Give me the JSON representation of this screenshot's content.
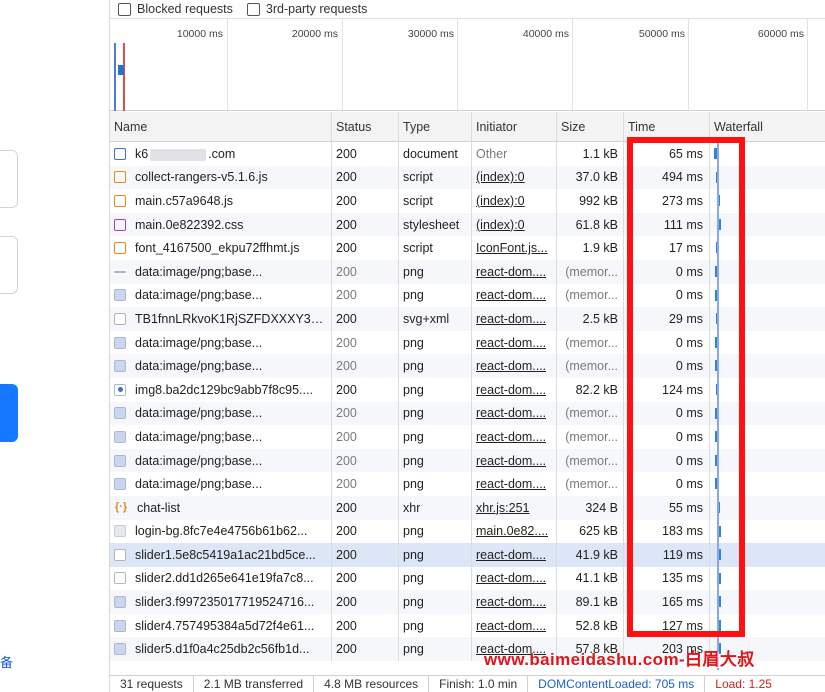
{
  "filters": {
    "blocked_requests": "Blocked requests",
    "third_party": "3rd-party requests"
  },
  "overview": {
    "ticks": [
      "10000 ms",
      "20000 ms",
      "30000 ms",
      "40000 ms",
      "50000 ms",
      "60000 ms"
    ]
  },
  "columns": {
    "name": "Name",
    "status": "Status",
    "type": "Type",
    "initiator": "Initiator",
    "size": "Size",
    "time": "Time",
    "waterfall": "Waterfall"
  },
  "rows": [
    {
      "icon": "document-icon",
      "name_prefix": "k6",
      "name_suffix": ".com",
      "status": "200",
      "type": "document",
      "initiator": "Other",
      "size": "1.1 kB",
      "time": "65 ms"
    },
    {
      "icon": "script-icon",
      "name": "collect-rangers-v5.1.6.js",
      "status": "200",
      "type": "script",
      "initiator": "(index):0",
      "size": "37.0 kB",
      "time": "494 ms"
    },
    {
      "icon": "script-icon",
      "name": "main.c57a9648.js",
      "status": "200",
      "type": "script",
      "initiator": "(index):0",
      "size": "992 kB",
      "time": "273 ms"
    },
    {
      "icon": "stylesheet-icon",
      "name": "main.0e822392.css",
      "status": "200",
      "type": "stylesheet",
      "initiator": "(index):0",
      "size": "61.8 kB",
      "time": "111 ms"
    },
    {
      "icon": "script-icon",
      "name": "font_4167500_ekpu72ffhmt.js",
      "status": "200",
      "type": "script",
      "initiator": "IconFont.js...",
      "size": "1.9 kB",
      "time": "17 ms"
    },
    {
      "icon": "line-image-icon",
      "name": "data:image/png;base...",
      "status": "200",
      "type": "png",
      "initiator": "react-dom....",
      "size": "(memor...",
      "time": "0 ms"
    },
    {
      "icon": "image-icon",
      "name": "data:image/png;base...",
      "status": "200",
      "type": "png",
      "initiator": "react-dom....",
      "size": "(memor...",
      "time": "0 ms"
    },
    {
      "icon": "svg-icon",
      "name": "TB1fnnLRkvoK1RjSZFDXXXY3p...",
      "status": "200",
      "type": "svg+xml",
      "initiator": "react-dom....",
      "size": "2.5 kB",
      "time": "29 ms"
    },
    {
      "icon": "image-icon",
      "name": "data:image/png;base...",
      "status": "200",
      "type": "png",
      "initiator": "react-dom....",
      "size": "(memor...",
      "time": "0 ms"
    },
    {
      "icon": "image-icon",
      "name": "data:image/png;base...",
      "status": "200",
      "type": "png",
      "initiator": "react-dom....",
      "size": "(memor...",
      "time": "0 ms"
    },
    {
      "icon": "dot-image-icon",
      "name": "img8.ba2dc129bc9abb7f8c95....",
      "status": "200",
      "type": "png",
      "initiator": "react-dom....",
      "size": "82.2 kB",
      "time": "124 ms"
    },
    {
      "icon": "image-icon",
      "name": "data:image/png;base...",
      "status": "200",
      "type": "png",
      "initiator": "react-dom....",
      "size": "(memor...",
      "time": "0 ms"
    },
    {
      "icon": "image-icon",
      "name": "data:image/png;base...",
      "status": "200",
      "type": "png",
      "initiator": "react-dom....",
      "size": "(memor...",
      "time": "0 ms"
    },
    {
      "icon": "image-icon",
      "name": "data:image/png;base...",
      "status": "200",
      "type": "png",
      "initiator": "react-dom....",
      "size": "(memor...",
      "time": "0 ms"
    },
    {
      "icon": "image-icon",
      "name": "data:image/png;base...",
      "status": "200",
      "type": "png",
      "initiator": "react-dom....",
      "size": "(memor...",
      "time": "0 ms"
    },
    {
      "icon": "xhr-icon",
      "name": "chat-list",
      "status": "200",
      "type": "xhr",
      "initiator": "xhr.js:251",
      "size": "324 B",
      "time": "55 ms"
    },
    {
      "icon": "background-image-icon",
      "name": "login-bg.8fc7e4e4756b61b62...",
      "status": "200",
      "type": "png",
      "initiator": "main.0e82....",
      "size": "625 kB",
      "time": "183 ms"
    },
    {
      "icon": "svg-icon",
      "name": "slider1.5e8c5419a1ac21bd5ce...",
      "status": "200",
      "type": "png",
      "initiator": "react-dom....",
      "size": "41.9 kB",
      "time": "119 ms",
      "selected": true
    },
    {
      "icon": "svg-icon",
      "name": "slider2.dd1d265e641e19fa7c8...",
      "status": "200",
      "type": "png",
      "initiator": "react-dom....",
      "size": "41.1 kB",
      "time": "135 ms"
    },
    {
      "icon": "image-icon",
      "name": "slider3.f997235017719524716...",
      "status": "200",
      "type": "png",
      "initiator": "react-dom....",
      "size": "89.1 kB",
      "time": "165 ms"
    },
    {
      "icon": "image-icon",
      "name": "slider4.757495384a5d72f4e61...",
      "status": "200",
      "type": "png",
      "initiator": "react-dom....",
      "size": "52.8 kB",
      "time": "127 ms"
    },
    {
      "icon": "image-icon",
      "name": "slider5.d1f0a4c25db2c56fb1d...",
      "status": "200",
      "type": "png",
      "initiator": "react-dom....",
      "size": "57.8 kB",
      "time": "203 ms"
    }
  ],
  "watermark": "www.baimeidashu.com-白眉大叔",
  "left_page": {
    "char": "备"
  },
  "statusbar": {
    "requests": "31 requests",
    "transferred": "2.1 MB transferred",
    "resources": "4.8 MB resources",
    "finish": "Finish: 1.0 min",
    "dcl": "DOMContentLoaded: 705 ms",
    "load": "Load: 1.25"
  },
  "colors": {
    "highlight": "#ff1111",
    "dcl": "#1a5fd0",
    "load": "#d01f1f",
    "watermark": "#e0141a"
  }
}
